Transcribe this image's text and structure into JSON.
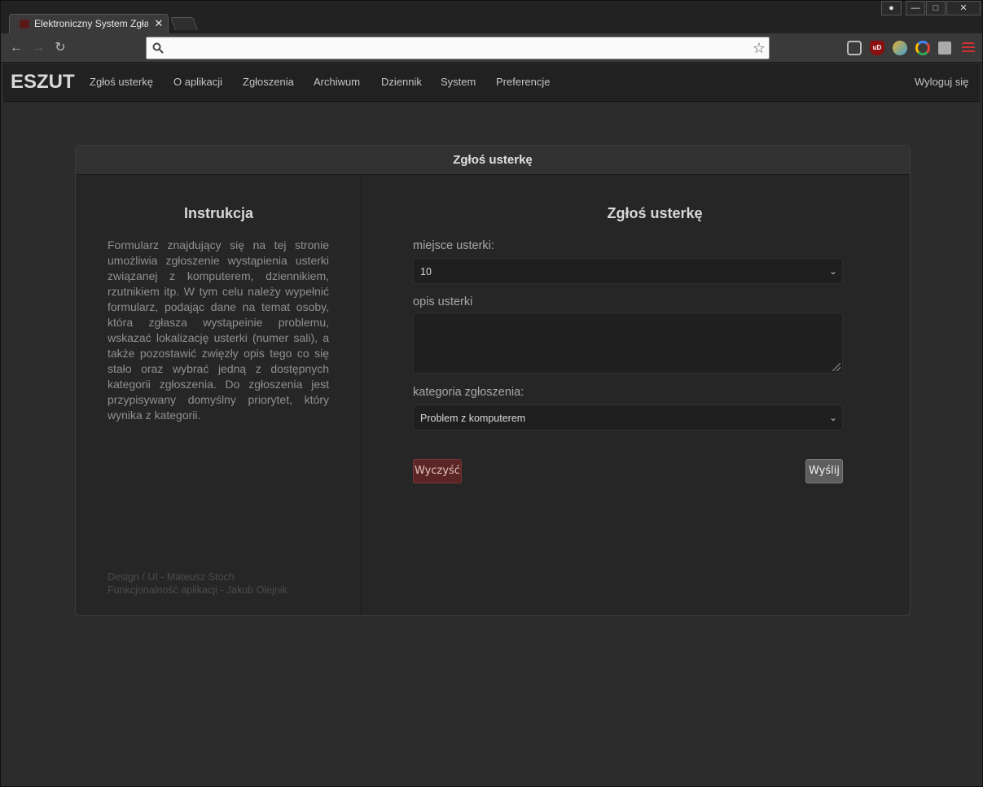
{
  "browser": {
    "tab_title": "Elektroniczny System Zgłasz",
    "tab_close": "✕",
    "omnibox_value": ""
  },
  "navbar": {
    "brand": "ESZUT",
    "links": [
      "Zgłoś usterkę",
      "O aplikacji",
      "Zgłoszenia",
      "Archiwum",
      "Dziennik",
      "System",
      "Preferencje"
    ],
    "logout": "Wyloguj się"
  },
  "panel": {
    "header_title": "Zgłoś usterkę",
    "left": {
      "title": "Instrukcja",
      "text": "Formularz znajdujący się na tej stronie umożliwia zgłoszenie wystąpienia usterki związanej z komputerem, dziennikiem, rzutnikiem itp. W tym celu należy wypełnić formularz, podając dane na temat osoby, która zgłasza wystąpeinie problemu, wskazać lokalizację usterki (numer sali), a także pozostawić zwięzły opis tego co się stało oraz wybrać jedną z dostępnych kategorii zgłoszenia. Do zgłoszenia jest przypisywany domyślny priorytet, który wynika z kategorii.",
      "credit_design": "Design / UI - Mateusz Stoch",
      "credit_func": "Funkcjonalność aplikacji - Jakub Olejnik"
    },
    "form": {
      "title": "Zgłoś usterkę",
      "location_label": "miejsce usterki:",
      "location_value": "10",
      "description_label": "opis usterki",
      "description_value": "",
      "category_label": "kategoria zgłoszenia:",
      "category_value": "Problem z komputerem",
      "clear_label": "Wyczyść",
      "send_label": "Wyślij"
    }
  },
  "colors": {
    "background": "#2c2c2c",
    "panel": "#262626",
    "clear_button": "#5b2525",
    "send_button": "#5e5e5e"
  },
  "icons": [
    "back-arrow-icon",
    "forward-arrow-icon",
    "reload-icon",
    "search-icon",
    "star-icon",
    "pocket-icon",
    "ublock-icon",
    "google-icon",
    "extensions-icon",
    "menu-icon",
    "chevron-down-icon"
  ]
}
